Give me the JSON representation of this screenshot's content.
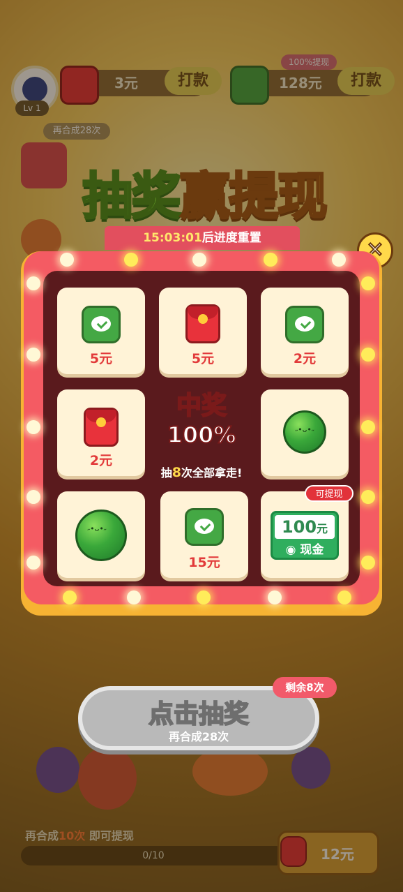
{
  "header": {
    "level": "Lv 1",
    "red_amount": "3元",
    "wechat_amount": "128元",
    "pay_label": "打款",
    "badge": "100%提现"
  },
  "side": {
    "combine_note": "再合成28次",
    "lottery_label": "抽奖"
  },
  "popup": {
    "title_part1": "抽奖",
    "title_part2": "赢提现",
    "reset_time": "15:03:01",
    "reset_suffix": "后进度重置",
    "center_title": "中奖",
    "center_percent": "100%",
    "center_note_prefix": "抽",
    "center_note_count": "8",
    "center_note_suffix": "次全部拿走!",
    "withdraw_badge": "可提现",
    "cash_amount": "100",
    "cash_unit": "元",
    "cash_label": "现金",
    "prizes": [
      {
        "label": "5元",
        "icon": "wechat-icon"
      },
      {
        "label": "5元",
        "icon": "red-packet-icon"
      },
      {
        "label": "2元",
        "icon": "wechat-icon"
      },
      {
        "label": "2元",
        "icon": "red-packet-icon"
      },
      {
        "label": "",
        "icon": "watermelon-icon"
      },
      {
        "label": "",
        "icon": "watermelon-icon"
      },
      {
        "label": "15元",
        "icon": "wechat-icon"
      }
    ]
  },
  "draw": {
    "label": "点击抽奖",
    "sub": "再合成28次",
    "remaining": "剩余8次"
  },
  "bottom": {
    "hint_prefix": "再合成",
    "hint_count": "10次",
    "hint_suffix": "即可提现",
    "progress": "0/10",
    "amount": "12元"
  },
  "colors": {
    "accent": "#f45b63",
    "gold": "#f7b333",
    "green": "#44a844"
  }
}
